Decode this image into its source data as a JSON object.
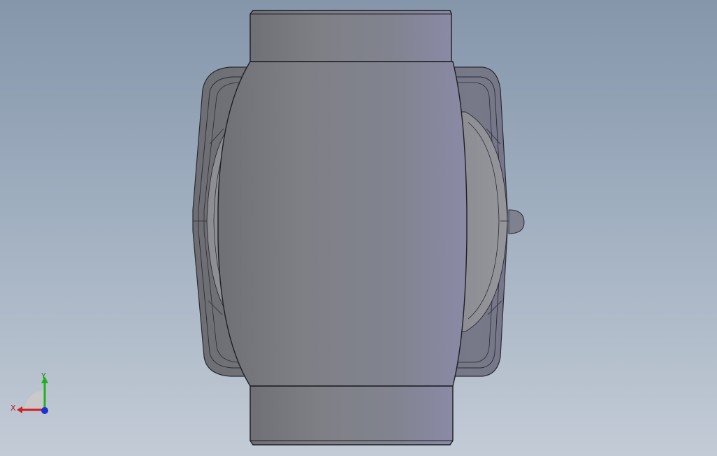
{
  "viewport": {
    "background_top": "#8596ab",
    "background_bottom": "#c3cbd6",
    "model_name": "",
    "model_color": "#7d7f88"
  },
  "triad": {
    "x_label": "X",
    "y_label": "Y",
    "x_color": "#d22020",
    "y_color": "#20b020",
    "z_color": "#2030d0"
  }
}
